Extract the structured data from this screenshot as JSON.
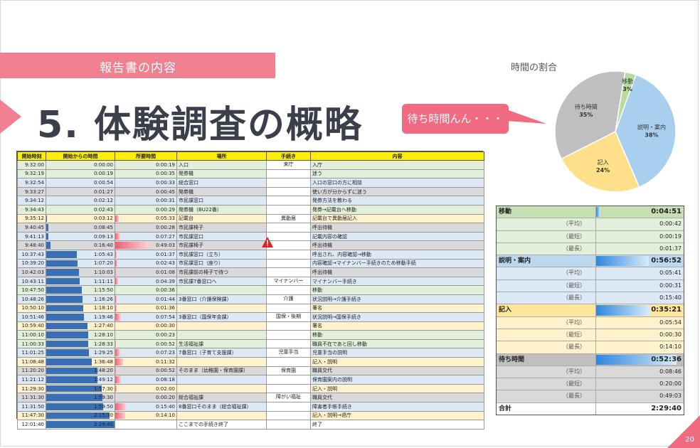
{
  "banner": {
    "label": "報告書の内容"
  },
  "title": "5. 体験調査の概略",
  "callout": {
    "text": "待ち時間んん・・・"
  },
  "table": {
    "headers": [
      "開始時刻",
      "開始からの時間",
      "所要時間",
      "場所",
      "手続き",
      "内容"
    ],
    "rows": [
      {
        "start": "9:32:00",
        "elapsed": "0:00:00",
        "dur": "0:00:19",
        "place": "入口",
        "proc": "来庁",
        "content": "入庁",
        "cat": "green",
        "e": 0,
        "d": 0
      },
      {
        "start": "9:32:19",
        "elapsed": "0:00:19",
        "dur": "0:00:35",
        "place": "発券機",
        "proc": "",
        "content": "迷う",
        "cat": "green",
        "e": 0,
        "d": 0
      },
      {
        "start": "9:32:54",
        "elapsed": "0:00:54",
        "dur": "0:00:33",
        "place": "総合窓口",
        "proc": "",
        "content": "入口の窓口の方に相談",
        "cat": "blue",
        "e": 0,
        "d": 0
      },
      {
        "start": "9:33:27",
        "elapsed": "0:01:27",
        "dur": "0:00:45",
        "place": "発券機",
        "proc": "",
        "content": "使い方が分からずに迷う",
        "cat": "gray",
        "e": 0,
        "d": 0
      },
      {
        "start": "9:34:12",
        "elapsed": "0:02:12",
        "dur": "0:00:31",
        "place": "市民課窓口",
        "proc": "",
        "content": "発券方法を教わる",
        "cat": "blue",
        "e": 0,
        "d": 0
      },
      {
        "start": "9:34:43",
        "elapsed": "0:02:43",
        "dur": "0:00:29",
        "place": "発券機（BU22番）",
        "proc": "",
        "content": "発券→記載台へ移動",
        "cat": "green",
        "e": 0,
        "d": 0
      },
      {
        "start": "9:35:12",
        "elapsed": "0:03:12",
        "dur": "0:05:33",
        "place": "記載台",
        "proc": "異動届",
        "content": "記載台で異動届記入",
        "cat": "yellow",
        "e": 0.01,
        "d": 0.06
      },
      {
        "start": "9:40:45",
        "elapsed": "0:08:45",
        "dur": "0:00:28",
        "place": "市民課椅子",
        "proc": "",
        "content": "呼出待機",
        "cat": "gray",
        "e": 0.03,
        "d": 0
      },
      {
        "start": "9:41:13",
        "elapsed": "0:09:13",
        "dur": "0:07:27",
        "place": "市民課窓口",
        "proc": "",
        "content": "記載内容の確認",
        "cat": "blue",
        "e": 0.03,
        "d": 0.08
      },
      {
        "start": "9:48:40",
        "elapsed": "0:16:40",
        "dur": "0:49:03",
        "place": "市民課椅子",
        "proc": "",
        "content": "呼出待機",
        "cat": "gray",
        "e": 0.06,
        "d": 0.55
      },
      {
        "start": "10:37:43",
        "elapsed": "1:05:43",
        "dur": "0:01:37",
        "place": "市民課窓口（立ち）",
        "proc": "",
        "content": "呼出され、内容確認→移動",
        "cat": "blue",
        "e": 0.45,
        "d": 0.02
      },
      {
        "start": "10:39:20",
        "elapsed": "1:07:20",
        "dur": "0:02:43",
        "place": "市民課窓口（座り）",
        "proc": "",
        "content": "内容確認→マイナンバー手続きのため移動手続",
        "cat": "blue",
        "e": 0.46,
        "d": 0.03
      },
      {
        "start": "10:42:03",
        "elapsed": "1:10:03",
        "dur": "0:01:08",
        "place": "市民課前の椅子で待つ",
        "proc": "",
        "content": "呼出待機",
        "cat": "gray",
        "e": 0.48,
        "d": 0.01
      },
      {
        "start": "10:43:11",
        "elapsed": "1:11:11",
        "dur": "0:04:39",
        "place": "市民課7番窓口へ",
        "proc": "マイナンバー",
        "content": "マイナンバー手続き",
        "cat": "blue",
        "e": 0.49,
        "d": 0.05
      },
      {
        "start": "10:47:50",
        "elapsed": "1:15:50",
        "dur": "0:00:36",
        "place": "",
        "proc": "",
        "content": "移動",
        "cat": "green",
        "e": 0.52,
        "d": 0
      },
      {
        "start": "10:48:26",
        "elapsed": "1:16:26",
        "dur": "0:01:44",
        "place": "3番窓口（介護保険課）",
        "proc": "介護",
        "content": "状況説明→介護手続き",
        "cat": "blue",
        "e": 0.53,
        "d": 0.02
      },
      {
        "start": "10:50:10",
        "elapsed": "1:18:10",
        "dur": "0:01:36",
        "place": "",
        "proc": "",
        "content": "署名",
        "cat": "yellow",
        "e": 0.54,
        "d": 0.02
      },
      {
        "start": "10:51:46",
        "elapsed": "1:19:46",
        "dur": "0:07:54",
        "place": "3番窓口（国保年金課）",
        "proc": "国保・後期",
        "content": "状況説明→国保手続き",
        "cat": "blue",
        "e": 0.55,
        "d": 0.09
      },
      {
        "start": "10:59:40",
        "elapsed": "1:27:40",
        "dur": "0:00:30",
        "place": "",
        "proc": "",
        "content": "署名",
        "cat": "yellow",
        "e": 0.6,
        "d": 0
      },
      {
        "start": "11:00:10",
        "elapsed": "1:28:10",
        "dur": "0:00:23",
        "place": "",
        "proc": "",
        "content": "移動",
        "cat": "green",
        "e": 0.61,
        "d": 0
      },
      {
        "start": "11:00:33",
        "elapsed": "1:28:33",
        "dur": "0:00:52",
        "place": "生活福祉課",
        "proc": "",
        "content": "職員不在であと回し移動",
        "cat": "green",
        "e": 0.61,
        "d": 0.01
      },
      {
        "start": "11:01:25",
        "elapsed": "1:29:25",
        "dur": "0:07:23",
        "place": "7番窓口（子育て支援課）",
        "proc": "児童手当",
        "content": "児童手当の説明",
        "cat": "blue",
        "e": 0.62,
        "d": 0.08
      },
      {
        "start": "11:08:48",
        "elapsed": "1:36:48",
        "dur": "0:11:32",
        "place": "",
        "proc": "",
        "content": "記入・説明",
        "cat": "yellow",
        "e": 0.67,
        "d": 0.13
      },
      {
        "start": "11:20:20",
        "elapsed": "1:48:20",
        "dur": "0:00:52",
        "place": "そのまま（幼稚園・保育園課）",
        "proc": "保育園",
        "content": "職員交代",
        "cat": "gray",
        "e": 0.75,
        "d": 0.01
      },
      {
        "start": "11:21:12",
        "elapsed": "1:49:12",
        "dur": "0:08:18",
        "place": "",
        "proc": "",
        "content": "保育園案内の説明",
        "cat": "blue",
        "e": 0.75,
        "d": 0.09
      },
      {
        "start": "11:29:30",
        "elapsed": "1:57:30",
        "dur": "0:02:00",
        "place": "",
        "proc": "",
        "content": "記入・説明",
        "cat": "yellow",
        "e": 0.81,
        "d": 0.02
      },
      {
        "start": "11:31:30",
        "elapsed": "1:59:30",
        "dur": "0:00:20",
        "place": "総合福祉課",
        "proc": "障がい福祉",
        "content": "職員交代",
        "cat": "gray",
        "e": 0.82,
        "d": 0
      },
      {
        "start": "11:31:50",
        "elapsed": "1:59:50",
        "dur": "0:15:40",
        "place": "8番窓口そのまま（総合福祉課）",
        "proc": "",
        "content": "障害者手帳手続き",
        "cat": "blue",
        "e": 0.83,
        "d": 0.17
      },
      {
        "start": "11:47:30",
        "elapsed": "2:15:30",
        "dur": "0:14:10",
        "place": "",
        "proc": "",
        "content": "記入・説明→退庁",
        "cat": "yellow",
        "e": 0.93,
        "d": 0.16
      },
      {
        "start": "12:01:40",
        "elapsed": "2:29:40",
        "dur": "",
        "place": "ここまでの手続き終了",
        "proc": "",
        "content": "終了",
        "cat": "white",
        "e": 1.0,
        "d": 0
      }
    ]
  },
  "pie": {
    "title": "時間の割合",
    "slices": [
      {
        "label": "移動",
        "pct": "3%",
        "value": 3,
        "color": "#b8dca0"
      },
      {
        "label": "説明・案内",
        "pct": "38%",
        "value": 38,
        "color": "#a9cfee"
      },
      {
        "label": "記入",
        "pct": "24%",
        "value": 24,
        "color": "#ffe08a"
      },
      {
        "label": "待ち時間",
        "pct": "35%",
        "value": 35,
        "color": "#bfbfbf"
      }
    ]
  },
  "summary": {
    "rows": [
      {
        "label": "移動",
        "value": "0:04:51",
        "type": "hdr",
        "color": "#c6e0b4",
        "bar": 0.05
      },
      {
        "label": "（平均）",
        "value": "0:00:42",
        "type": "sub",
        "color": "#e2efda"
      },
      {
        "label": "（最短）",
        "value": "0:00:19",
        "type": "sub",
        "color": "#e2efda"
      },
      {
        "label": "（最長）",
        "value": "0:01:37",
        "type": "sub",
        "color": "#e2efda"
      },
      {
        "label": "説明・案内",
        "value": "0:56:52",
        "type": "hdr",
        "color": "#bdd7ee",
        "bar": 0.6
      },
      {
        "label": "（平均）",
        "value": "0:05:41",
        "type": "sub",
        "color": "#dde8f5"
      },
      {
        "label": "（最短）",
        "value": "0:00:31",
        "type": "sub",
        "color": "#dde8f5"
      },
      {
        "label": "（最長）",
        "value": "0:15:40",
        "type": "sub",
        "color": "#dde8f5"
      },
      {
        "label": "記入",
        "value": "0:35:21",
        "type": "hdr",
        "color": "#ffe699",
        "bar": 0.62
      },
      {
        "label": "（平均）",
        "value": "0:05:54",
        "type": "sub",
        "color": "#fff2cc"
      },
      {
        "label": "（最短）",
        "value": "0:00:30",
        "type": "sub",
        "color": "#fff2cc"
      },
      {
        "label": "（最長）",
        "value": "0:14:10",
        "type": "sub",
        "color": "#fff2cc"
      },
      {
        "label": "待ち時間",
        "value": "0:52:36",
        "type": "hdr",
        "color": "#bfbfbf",
        "bar": 0.92
      },
      {
        "label": "（平均）",
        "value": "0:08:46",
        "type": "sub",
        "color": "#d9d9d9"
      },
      {
        "label": "（最短）",
        "value": "0:20:00",
        "type": "sub",
        "color": "#d9d9d9"
      },
      {
        "label": "（最長）",
        "value": "0:49:03",
        "type": "sub",
        "color": "#d9d9d9"
      },
      {
        "label": "合計",
        "value": "2:29:40",
        "type": "hdr",
        "color": "#ffffff",
        "bar": 0
      }
    ]
  },
  "page_number": "20",
  "colors": {
    "accent": "#f08090",
    "bar": "#3a6fb5",
    "warn": "#e02020"
  },
  "icons": {
    "warning": "warning-icon"
  }
}
